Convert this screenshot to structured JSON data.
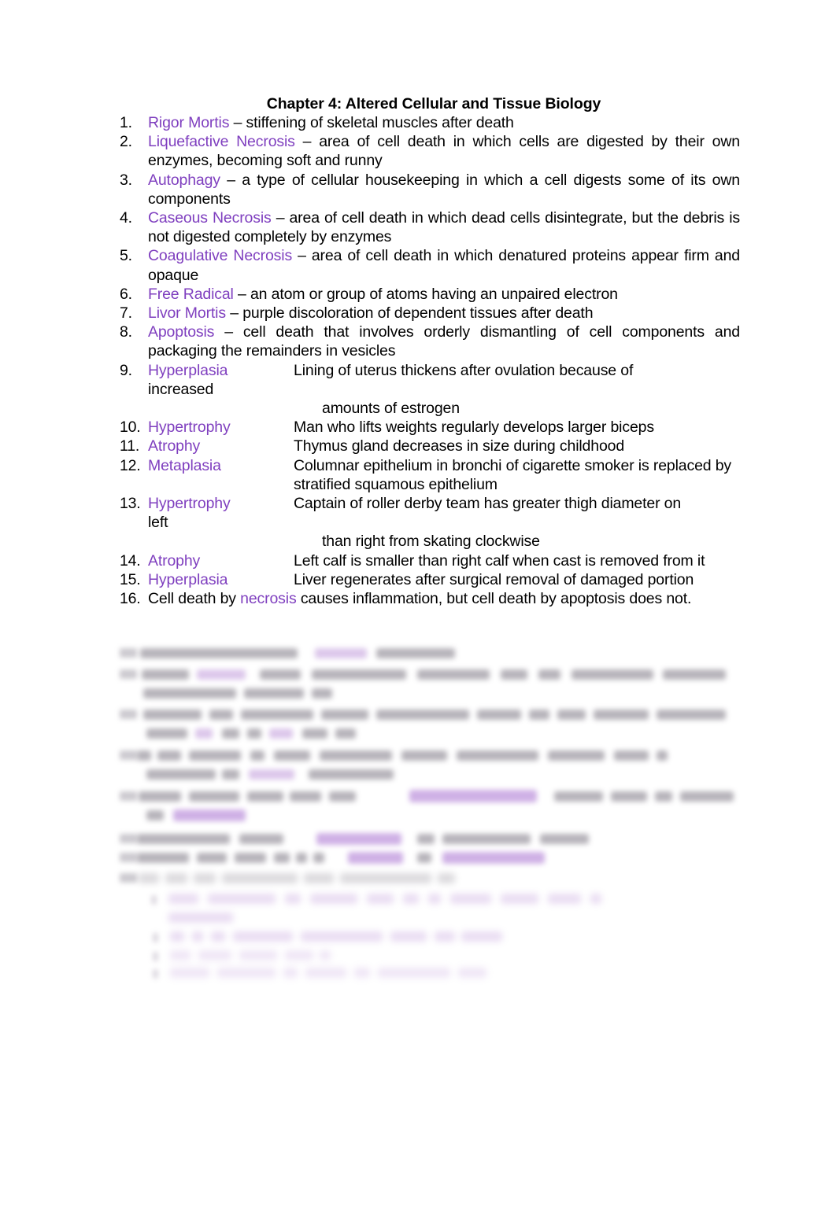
{
  "document": {
    "title": "Chapter 4: Altered Cellular and Tissue Biology",
    "accent_color": "#7F3FBF",
    "text_color": "#000000",
    "background_color": "#FFFFFF"
  },
  "definitions": [
    {
      "number": "1.",
      "term": "Rigor Mortis",
      "definition": " – stiffening of skeletal muscles after death"
    },
    {
      "number": "2.",
      "term": "Liquefactive Necrosis",
      "definition": " – area of cell death in which cells are digested by their own enzymes, becoming soft and runny"
    },
    {
      "number": "3.",
      "term": "Autophagy",
      "definition": " – a type of cellular housekeeping in which a cell digests some of its own components"
    },
    {
      "number": "4.",
      "term": "Caseous Necrosis",
      "definition": " – area of cell death in which dead cells disintegrate, but the debris is not digested completely by enzymes"
    },
    {
      "number": "5.",
      "term": "Coagulative Necrosis",
      "definition": " – area of cell death in which denatured proteins appear firm and opaque"
    },
    {
      "number": "6.",
      "term": "Free Radical",
      "definition": " – an atom or group of atoms having an unpaired electron"
    },
    {
      "number": "7.",
      "term": "Livor Mortis",
      "definition": " – purple discoloration of dependent tissues after death"
    },
    {
      "number": "8.",
      "term": "Apoptosis",
      "definition": " – cell death that involves orderly dismantling of cell components and packaging the remainders in vesicles"
    }
  ],
  "matching": [
    {
      "number": "9.",
      "term": "Hyperplasia",
      "description": "Lining of uterus thickens after ovulation because of",
      "continuation_left": "increased",
      "continuation_column": "amounts of estrogen"
    },
    {
      "number": "10.",
      "term": "Hypertrophy",
      "description": "Man who lifts weights regularly develops larger biceps",
      "continuation_left": "",
      "continuation_column": ""
    },
    {
      "number": "11.",
      "term": "Atrophy",
      "description": "Thymus gland decreases in size during childhood",
      "continuation_left": "",
      "continuation_column": ""
    },
    {
      "number": "12.",
      "term": "Metaplasia",
      "description": "Columnar epithelium in bronchi of cigarette smoker is replaced by stratified squamous epithelium",
      "continuation_left": "",
      "continuation_column": ""
    },
    {
      "number": "13.",
      "term": "Hypertrophy",
      "description": "Captain of roller derby team has greater thigh diameter on",
      "continuation_left": "left",
      "continuation_column": "than right from skating clockwise"
    },
    {
      "number": "14.",
      "term": "Atrophy",
      "description": "Left calf is smaller than right calf when cast is removed from it",
      "continuation_left": "",
      "continuation_column": ""
    },
    {
      "number": "15.",
      "term": "Hyperplasia",
      "description": "Liver regenerates after surgical removal of damaged portion",
      "continuation_left": "",
      "continuation_column": ""
    }
  ],
  "statement": {
    "number": "16.",
    "text_before": "Cell death by ",
    "highlighted_word": "necrosis",
    "text_after": " causes inflammation, but cell death by apoptosis does not."
  }
}
